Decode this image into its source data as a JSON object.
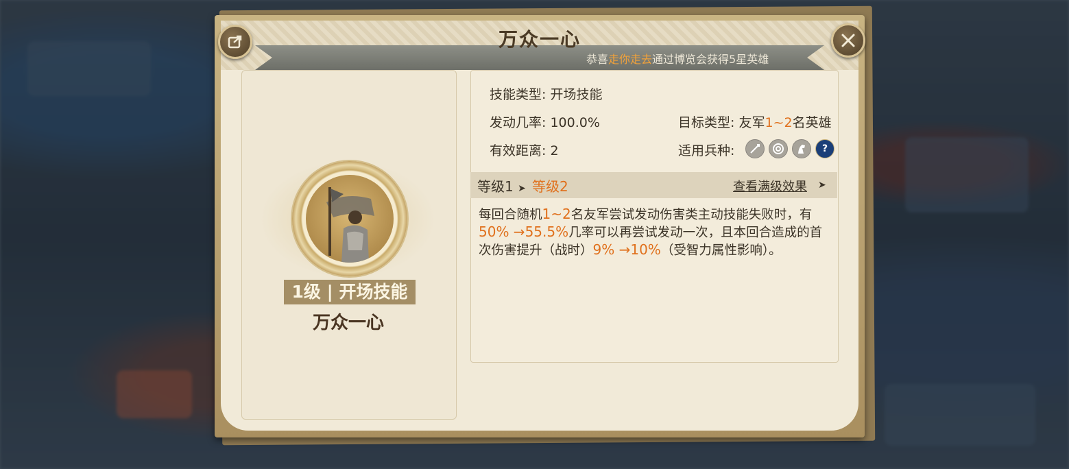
{
  "dialog": {
    "title": "万众一心",
    "share_icon": "share-icon",
    "close_icon": "close-icon"
  },
  "announcement": {
    "prefix": "恭喜",
    "player": "走你走去",
    "suffix": "通过博览会获得5星英雄"
  },
  "skill": {
    "level_tag": "1级 | 开场技能",
    "name": "万众一心",
    "portrait_icon": "flag-bearer-hero-icon"
  },
  "info": {
    "type_label": "技能类型:",
    "type_value": "开场技能",
    "rate_label": "发动几率:",
    "rate_value": "100.0%",
    "target_label": "目标类型:",
    "target_prefix": "友军",
    "target_range": "1~2",
    "target_suffix": "名英雄",
    "range_label": "有效距离:",
    "range_value": "2",
    "troop_label": "适用兵种:",
    "troop_icons": [
      "infantry-icon",
      "archer-icon",
      "cavalry-icon",
      "help-icon"
    ]
  },
  "levels": {
    "current": "等级1",
    "arrow": "➤",
    "next": "等级2",
    "view_max": "查看满级效果",
    "view_max_arrow": "➤"
  },
  "description": {
    "p1a": "每回合随机",
    "p1b": "1~2",
    "p1c": "名友军尝试发动伤害类主动技能失败时，有",
    "p2a": "50% →55.5%",
    "p2b": "几率可以再尝试发动一次，且本回合造成的首次伤害提升（战时）",
    "p3a": "9% →10%",
    "p3b": "（受智力属性影响）。"
  },
  "colors": {
    "highlight": "#e0701c",
    "announce_highlight": "#f2a23a",
    "paper": "#f1ead8",
    "frame": "#b89c6a"
  }
}
